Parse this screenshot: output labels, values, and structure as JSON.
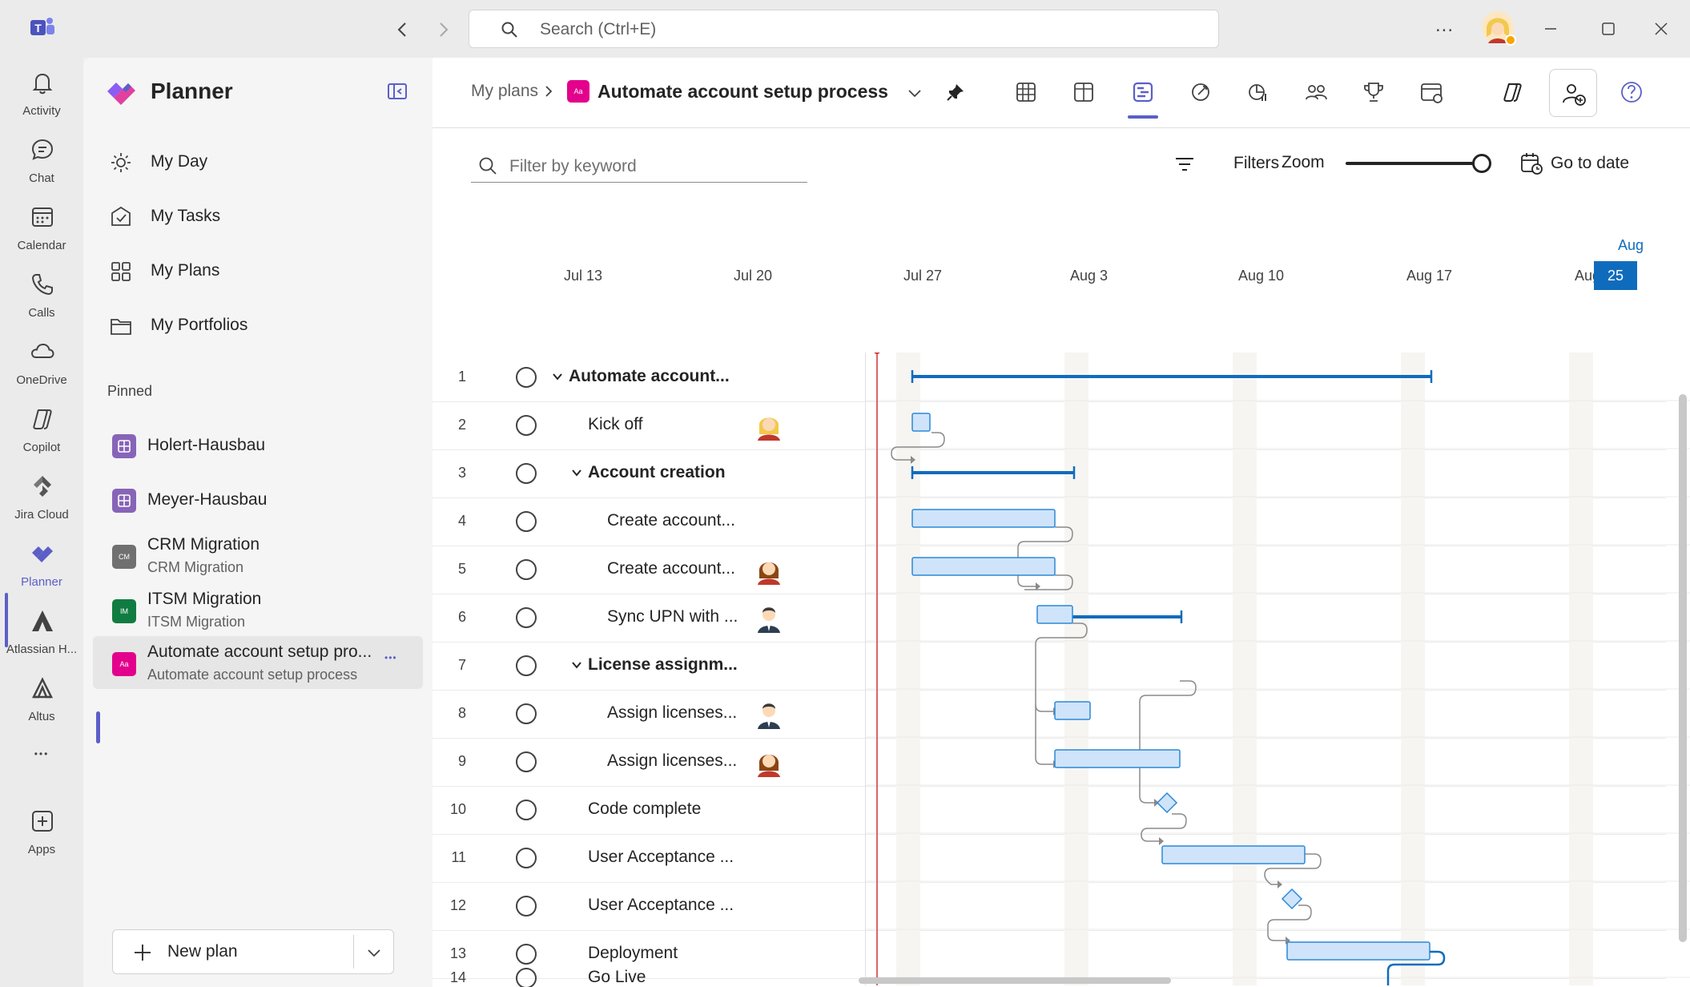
{
  "titlebar": {
    "search_placeholder": "Search (Ctrl+E)",
    "more_label": "..."
  },
  "rail": {
    "items": [
      {
        "label": "Activity",
        "icon": "bell-icon"
      },
      {
        "label": "Chat",
        "icon": "chat-icon"
      },
      {
        "label": "Calendar",
        "icon": "calendar-icon"
      },
      {
        "label": "Calls",
        "icon": "phone-icon"
      },
      {
        "label": "OneDrive",
        "icon": "cloud-icon"
      },
      {
        "label": "Copilot",
        "icon": "copilot-icon"
      },
      {
        "label": "Jira Cloud",
        "icon": "jira-icon"
      },
      {
        "label": "Planner",
        "icon": "planner-icon"
      },
      {
        "label": "Atlassian H...",
        "icon": "atlassian-icon"
      },
      {
        "label": "Altus",
        "icon": "altus-icon"
      },
      {
        "label": "",
        "icon": "more-icon"
      },
      {
        "label": "Apps",
        "icon": "apps-icon"
      }
    ],
    "more": "•••"
  },
  "nav": {
    "title": "Planner",
    "items": [
      {
        "label": "My Day",
        "icon": "sun-icon"
      },
      {
        "label": "My Tasks",
        "icon": "task-check-icon"
      },
      {
        "label": "My Plans",
        "icon": "grid-icon"
      },
      {
        "label": "My Portfolios",
        "icon": "folder-icon"
      }
    ],
    "pinned_label": "Pinned",
    "pinned": [
      {
        "title": "Holert-Hausbau",
        "subtitle": "",
        "badge": "",
        "color": "#8764b8"
      },
      {
        "title": "Meyer-Hausbau",
        "subtitle": "",
        "badge": "",
        "color": "#8764b8"
      },
      {
        "title": "CRM Migration",
        "subtitle": "CRM Migration",
        "badge": "CM",
        "color": "#707070"
      },
      {
        "title": "ITSM Migration",
        "subtitle": "ITSM Migration",
        "badge": "IM",
        "color": "#107c41"
      },
      {
        "title": "Automate account setup pro...",
        "subtitle": "Automate account setup process",
        "badge": "Aa",
        "color": "#e3008c"
      }
    ],
    "more_dots": "•••",
    "new_plan": "New plan"
  },
  "header": {
    "breadcrumb": "My plans",
    "plan_title": "Automate account setup process",
    "plan_badge": "Aa",
    "accent": "#5b5fc7"
  },
  "toolbar": {
    "filter_placeholder": "Filter by keyword",
    "filters": "Filters",
    "zoom": "Zoom",
    "go_to_date": "Go to date",
    "zoom_level": 1.0
  },
  "timeline": {
    "dates": [
      "Jul 13",
      "Jul 20",
      "Jul 27",
      "Aug 3",
      "Aug 10",
      "Aug 17",
      "Aug"
    ],
    "today_month": "Aug",
    "today_day": "25"
  },
  "tasks": [
    {
      "num": "1",
      "title": "Automate account...",
      "level": 0,
      "group": true,
      "avatar": ""
    },
    {
      "num": "2",
      "title": "Kick off",
      "level": 1,
      "group": false,
      "avatar": "blonde-woman-avatar"
    },
    {
      "num": "3",
      "title": "Account creation",
      "level": 1,
      "group": true,
      "avatar": ""
    },
    {
      "num": "4",
      "title": "Create account...",
      "level": 2,
      "group": false,
      "avatar": ""
    },
    {
      "num": "5",
      "title": "Create account...",
      "level": 2,
      "group": false,
      "avatar": "brunette-woman-avatar"
    },
    {
      "num": "6",
      "title": "Sync UPN with ...",
      "level": 2,
      "group": false,
      "avatar": "man-suit-avatar"
    },
    {
      "num": "7",
      "title": "License assignm...",
      "level": 1,
      "group": true,
      "avatar": ""
    },
    {
      "num": "8",
      "title": "Assign licenses...",
      "level": 2,
      "group": false,
      "avatar": "man-suit-avatar"
    },
    {
      "num": "9",
      "title": "Assign licenses...",
      "level": 2,
      "group": false,
      "avatar": "brunette-woman-avatar"
    },
    {
      "num": "10",
      "title": "Code complete",
      "level": 1,
      "group": false,
      "avatar": ""
    },
    {
      "num": "11",
      "title": "User Acceptance ...",
      "level": 1,
      "group": false,
      "avatar": ""
    },
    {
      "num": "12",
      "title": "User Acceptance ...",
      "level": 1,
      "group": false,
      "avatar": ""
    },
    {
      "num": "13",
      "title": "Deployment",
      "level": 1,
      "group": false,
      "avatar": ""
    },
    {
      "num": "14",
      "title": "Go Live",
      "level": 1,
      "group": false,
      "avatar": ""
    }
  ]
}
